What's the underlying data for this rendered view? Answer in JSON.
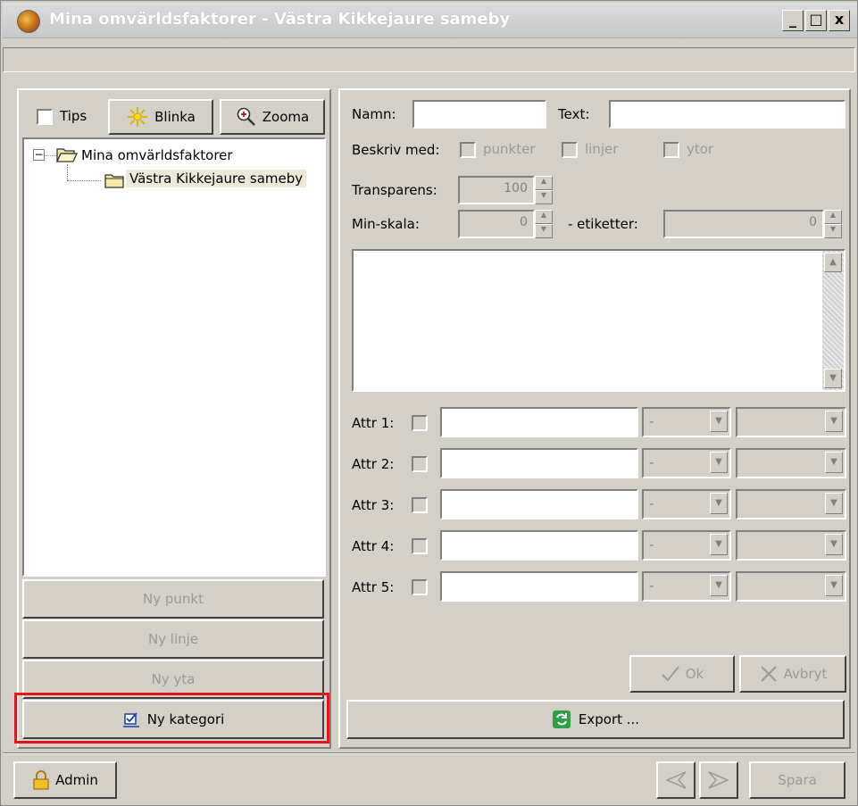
{
  "window": {
    "title": "Mina omvärldsfaktorer - Västra Kikkejaure sameby",
    "minimize": "_",
    "maximize": "□",
    "close": "x"
  },
  "left": {
    "tips_label": "Tips",
    "blinka_label": "Blinka",
    "zooma_label": "Zooma",
    "tree": {
      "root_toggle": "−",
      "root_label": "Mina omvärldsfaktorer",
      "child_label": "Västra Kikkejaure sameby"
    },
    "ny_punkt": "Ny punkt",
    "ny_linje": "Ny linje",
    "ny_yta": "Ny yta",
    "ny_kategori": "Ny kategori"
  },
  "right": {
    "namn_label": "Namn:",
    "namn_value": "",
    "text_label": "Text:",
    "text_value": "",
    "beskriv_label": "Beskriv med:",
    "punkter_label": "punkter",
    "linjer_label": "linjer",
    "ytor_label": "ytor",
    "transparens_label": "Transparens:",
    "transparens_value": "100",
    "minskala_label": "Min-skala:",
    "minskala_value": "0",
    "etiketter_label": "- etiketter:",
    "etiketter_value": "0",
    "attrs": [
      {
        "label": "Attr 1:",
        "combo": "-"
      },
      {
        "label": "Attr 2:",
        "combo": "-"
      },
      {
        "label": "Attr 3:",
        "combo": "-"
      },
      {
        "label": "Attr 4:",
        "combo": "-"
      },
      {
        "label": "Attr 5:",
        "combo": "-"
      }
    ],
    "ok_label": "Ok",
    "avbryt_label": "Avbryt",
    "export_label": "Export ..."
  },
  "bottom": {
    "admin_label": "Admin",
    "spara_label": "Spara"
  },
  "colors": {
    "highlight": "#e0161c",
    "export_icon": "#2ea043",
    "folder": "#f5e9a8"
  }
}
